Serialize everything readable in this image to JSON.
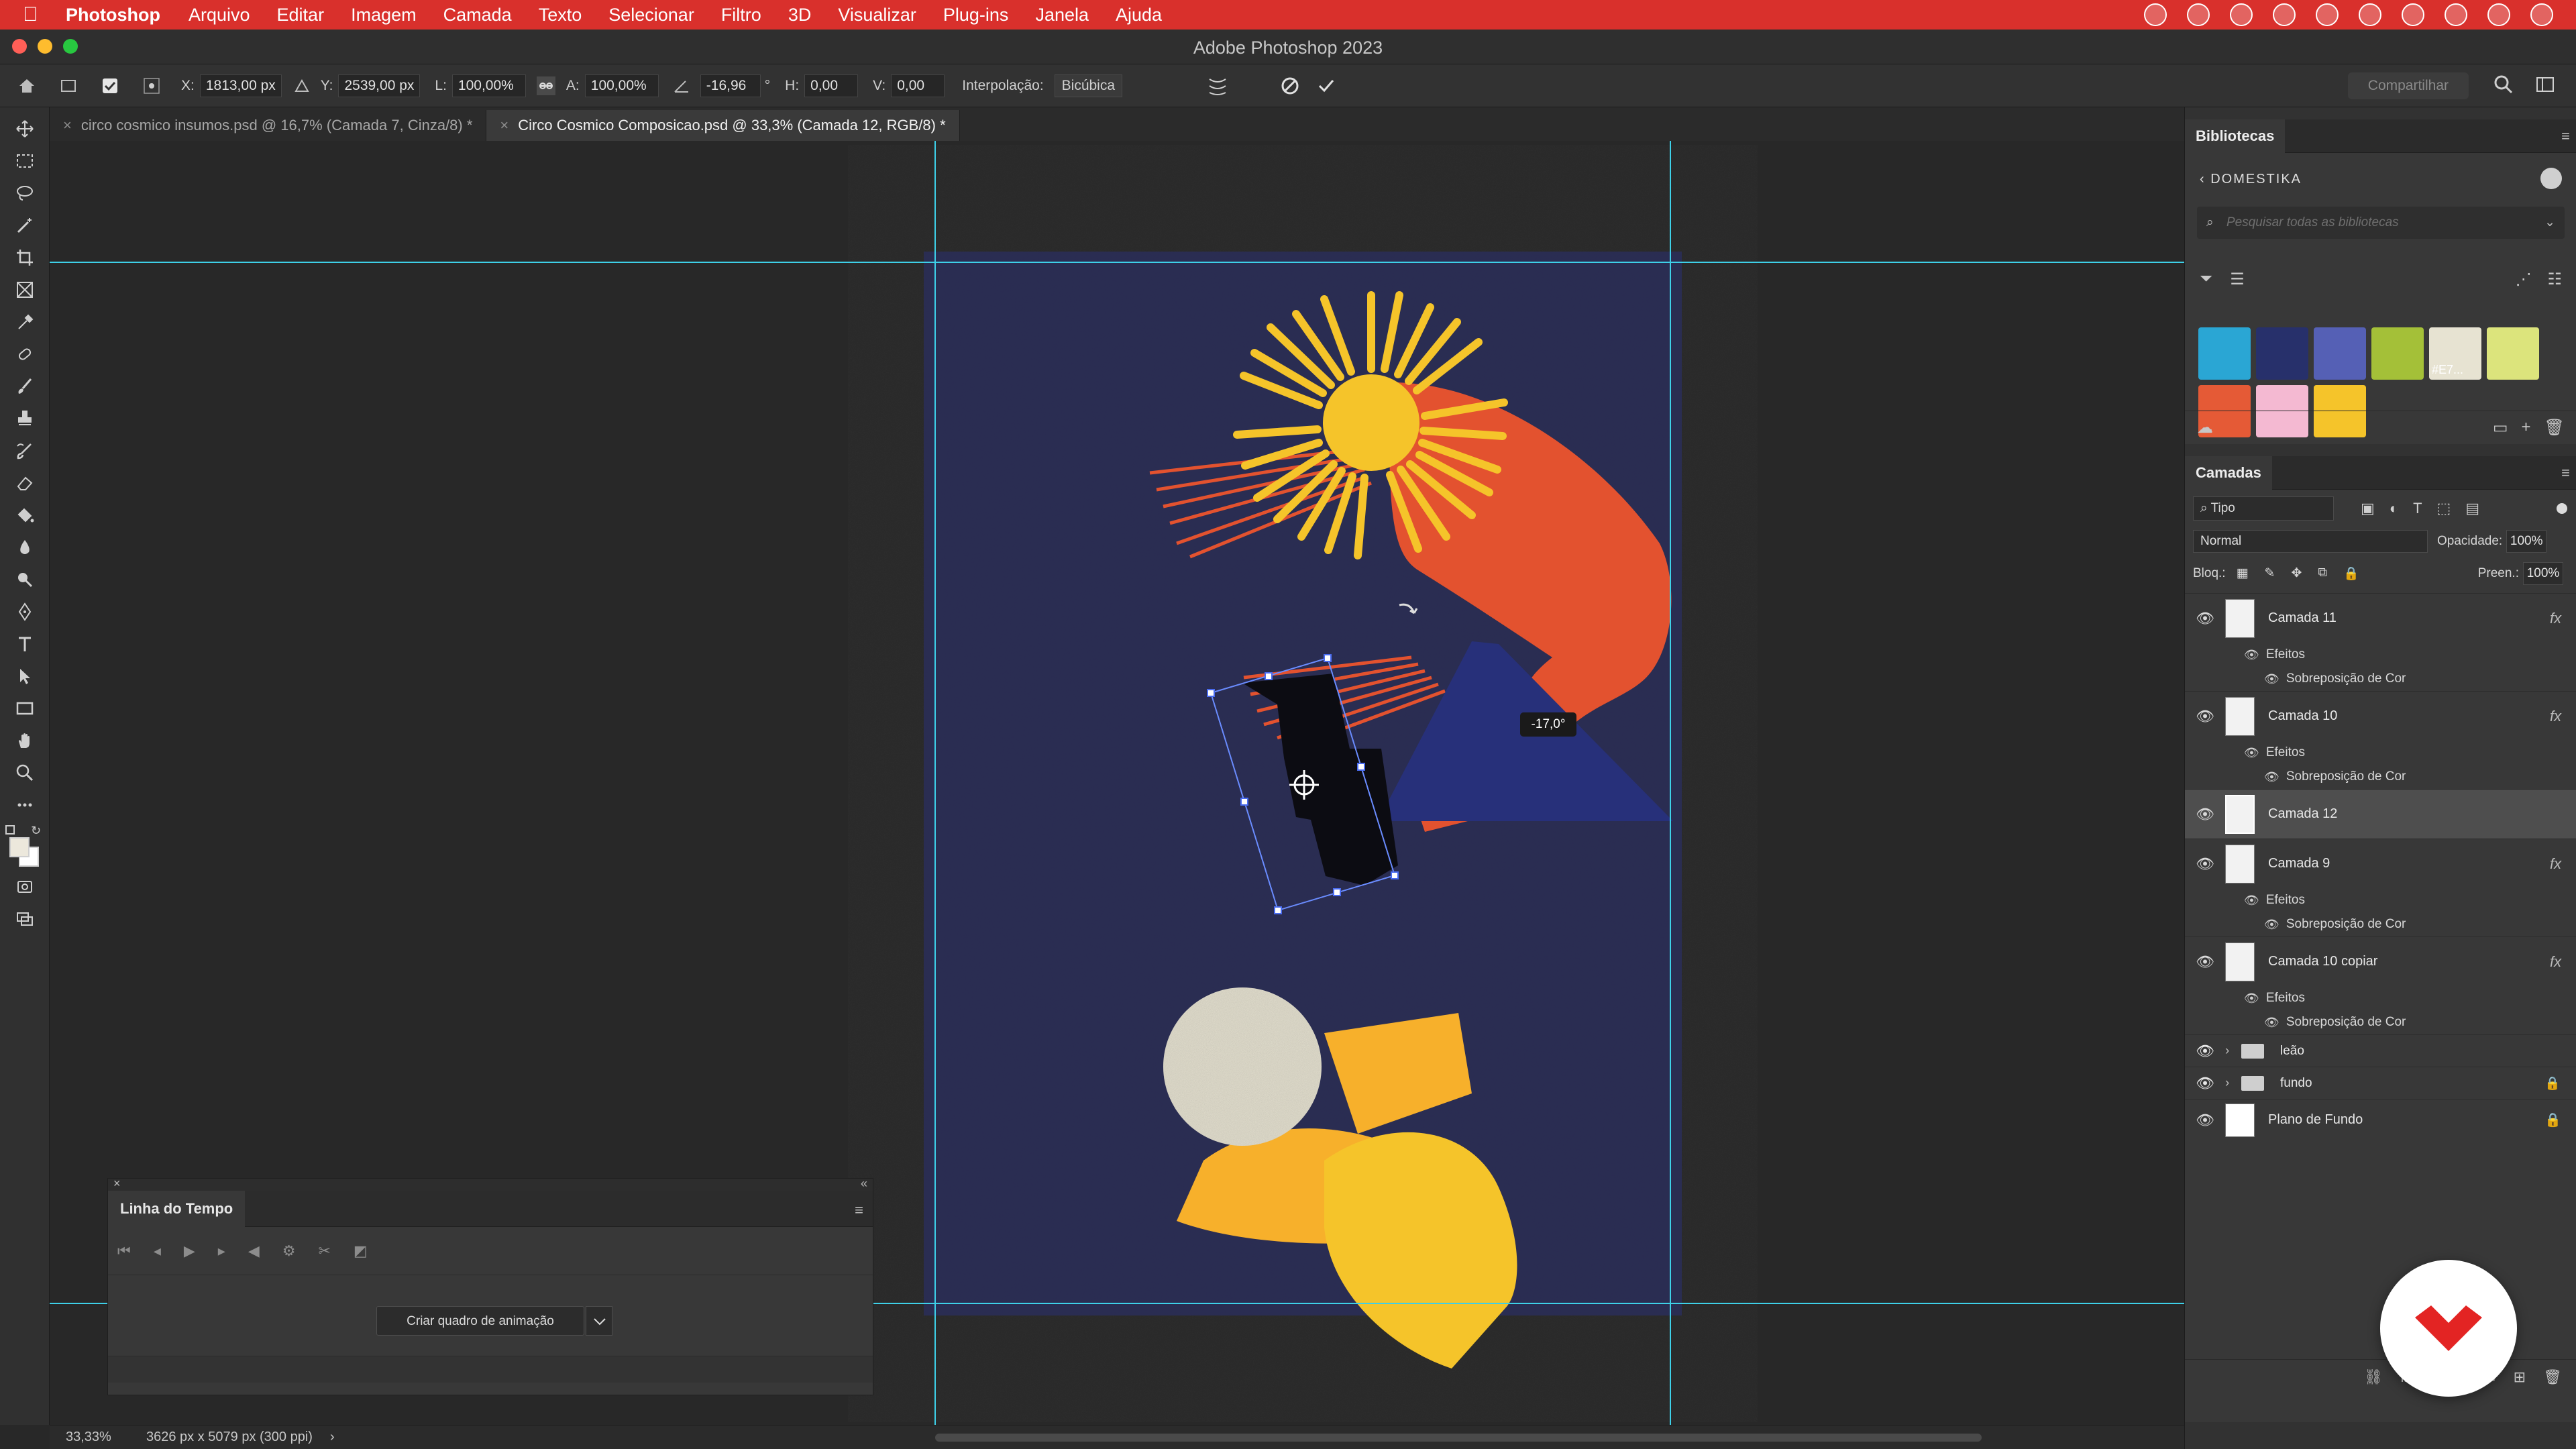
{
  "menubar": {
    "app_name": "Photoshop",
    "items": [
      "Arquivo",
      "Editar",
      "Imagem",
      "Camada",
      "Texto",
      "Selecionar",
      "Filtro",
      "3D",
      "Visualizar",
      "Plug-ins",
      "Janela",
      "Ajuda"
    ]
  },
  "window": {
    "title": "Adobe Photoshop 2023"
  },
  "options": {
    "x_label": "X:",
    "x_value": "1813,00 px",
    "y_label": "Y:",
    "y_value": "2539,00 px",
    "w_label": "L:",
    "w_value": "100,00%",
    "h_label": "A:",
    "h_value": "100,00%",
    "angle_value": "-16,96",
    "angle_unit": "°",
    "hskew_label": "H:",
    "hskew_value": "0,00",
    "vskew_label": "V:",
    "vskew_value": "0,00",
    "interp_label": "Interpolação:",
    "interp_value": "Bicúbica",
    "share_label": "Compartilhar"
  },
  "tabs": [
    {
      "label": "circo cosmico insumos.psd @ 16,7% (Camada 7, Cinza/8) *",
      "active": false
    },
    {
      "label": "Circo Cosmico Composicao.psd @ 33,3% (Camada 12, RGB/8) *",
      "active": true
    }
  ],
  "canvas": {
    "rotation_badge": "-17,0°"
  },
  "timeline": {
    "title": "Linha do Tempo",
    "create_button": "Criar quadro de animação"
  },
  "status": {
    "zoom": "33,33%",
    "doc_info": "3626 px x 5079 px (300 ppi)"
  },
  "libraries": {
    "title": "Bibliotecas",
    "library_name": "DOMESTIKA",
    "search_placeholder": "Pesquisar todas as bibliotecas",
    "swatches": [
      {
        "color": "#2aa6d4",
        "label": ""
      },
      {
        "color": "#27306b",
        "label": ""
      },
      {
        "color": "#5560b5",
        "label": ""
      },
      {
        "color": "#a4c038",
        "label": ""
      },
      {
        "color": "#e7e3d2",
        "label": "#E7..."
      },
      {
        "color": "#dce47c",
        "label": ""
      },
      {
        "color": "#e55a36",
        "label": ""
      },
      {
        "color": "#f4b9d2",
        "label": ""
      },
      {
        "color": "#f5c42a",
        "label": ""
      }
    ]
  },
  "layers_panel": {
    "title": "Camadas",
    "kind_filter": "Tipo",
    "blend_mode": "Normal",
    "opacity_label": "Opacidade:",
    "opacity_value": "100%",
    "lock_label": "Bloq.:",
    "fill_label": "Preen.:",
    "fill_value": "100%",
    "effects_label": "Efeitos",
    "color_overlay_label": "Sobreposição de Cor",
    "layers": [
      {
        "name": "Camada 11",
        "fx": true,
        "selected": false
      },
      {
        "name": "Camada 10",
        "fx": true,
        "selected": false
      },
      {
        "name": "Camada 12",
        "fx": false,
        "selected": true
      },
      {
        "name": "Camada 9",
        "fx": true,
        "selected": false
      },
      {
        "name": "Camada 10 copiar",
        "fx": true,
        "selected": false
      }
    ],
    "groups": [
      {
        "name": "leão",
        "locked": false
      },
      {
        "name": "fundo",
        "locked": true
      }
    ],
    "background": {
      "name": "Plano de Fundo",
      "locked": true
    }
  },
  "colors": {
    "menubar": "#d9302c",
    "canvas_bg": "#2f3158",
    "guide": "#3ed0e8"
  }
}
